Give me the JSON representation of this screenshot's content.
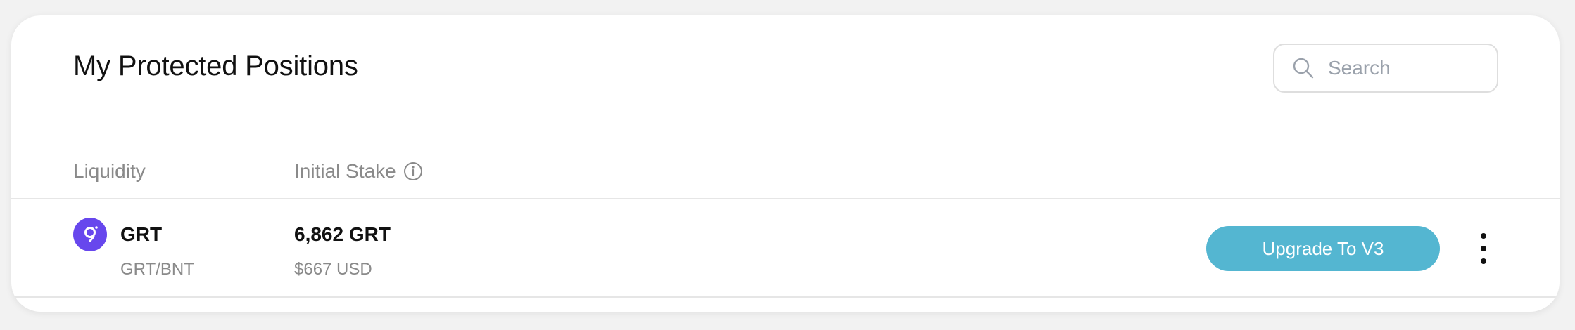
{
  "card": {
    "title": "My Protected Positions"
  },
  "search": {
    "placeholder": "Search",
    "value": "",
    "icon": "search-icon"
  },
  "table": {
    "columns": [
      {
        "label": "Liquidity"
      },
      {
        "label": "Initial Stake",
        "icon": "info-icon"
      }
    ],
    "rows": [
      {
        "token_symbol": "GRT",
        "token_pair": "GRT/BNT",
        "token_icon": "grt-token-icon",
        "initial_stake_amount": "6,862 GRT",
        "initial_stake_usd": "$667 USD",
        "action_label": "Upgrade To V3",
        "more_icon": "more-vertical-icon"
      }
    ]
  },
  "colors": {
    "accent": "#54b6d1",
    "token_bg": "#6747ed",
    "muted_text": "#8a8a8a",
    "primary_text": "#111111"
  }
}
